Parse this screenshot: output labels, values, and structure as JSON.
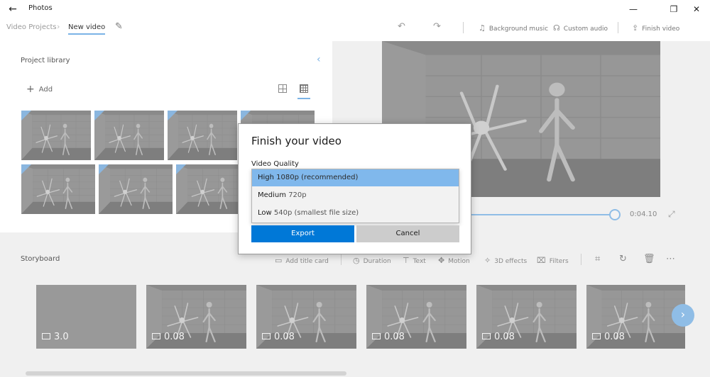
{
  "app": {
    "title": "Photos"
  },
  "window": {
    "minimize": "—",
    "maximize": "❐",
    "close": "✕"
  },
  "toolbar": {
    "breadcrumb_parent": "Video Projects",
    "breadcrumb_current": "New video",
    "background_music": "Background music",
    "custom_audio": "Custom audio",
    "finish_video": "Finish video"
  },
  "library": {
    "title": "Project library",
    "add_label": "Add"
  },
  "playback": {
    "time": "0:04.10",
    "position_fraction": 0.95
  },
  "storyboard": {
    "title": "Storyboard",
    "add_title_card": "Add title card",
    "duration": "Duration",
    "text": "Text",
    "motion": "Motion",
    "effects_3d": "3D effects",
    "filters": "Filters",
    "cards": [
      {
        "duration": "3.0"
      },
      {
        "duration": "0.08"
      },
      {
        "duration": "0.08"
      },
      {
        "duration": "0.08"
      },
      {
        "duration": "0.08"
      },
      {
        "duration": "0.08"
      }
    ]
  },
  "dialog": {
    "title": "Finish your video",
    "quality_label": "Video Quality",
    "options": [
      {
        "name": "High",
        "detail": "1080p (recommended)",
        "selected": true
      },
      {
        "name": "Medium",
        "detail": "720p",
        "selected": false
      },
      {
        "name": "Low",
        "detail": "540p (smallest file size)",
        "selected": false
      }
    ],
    "export_label": "Export",
    "cancel_label": "Cancel"
  },
  "colors": {
    "accent": "#0078d7",
    "selection": "#80b8ec",
    "highlight": "#8fbde6"
  }
}
